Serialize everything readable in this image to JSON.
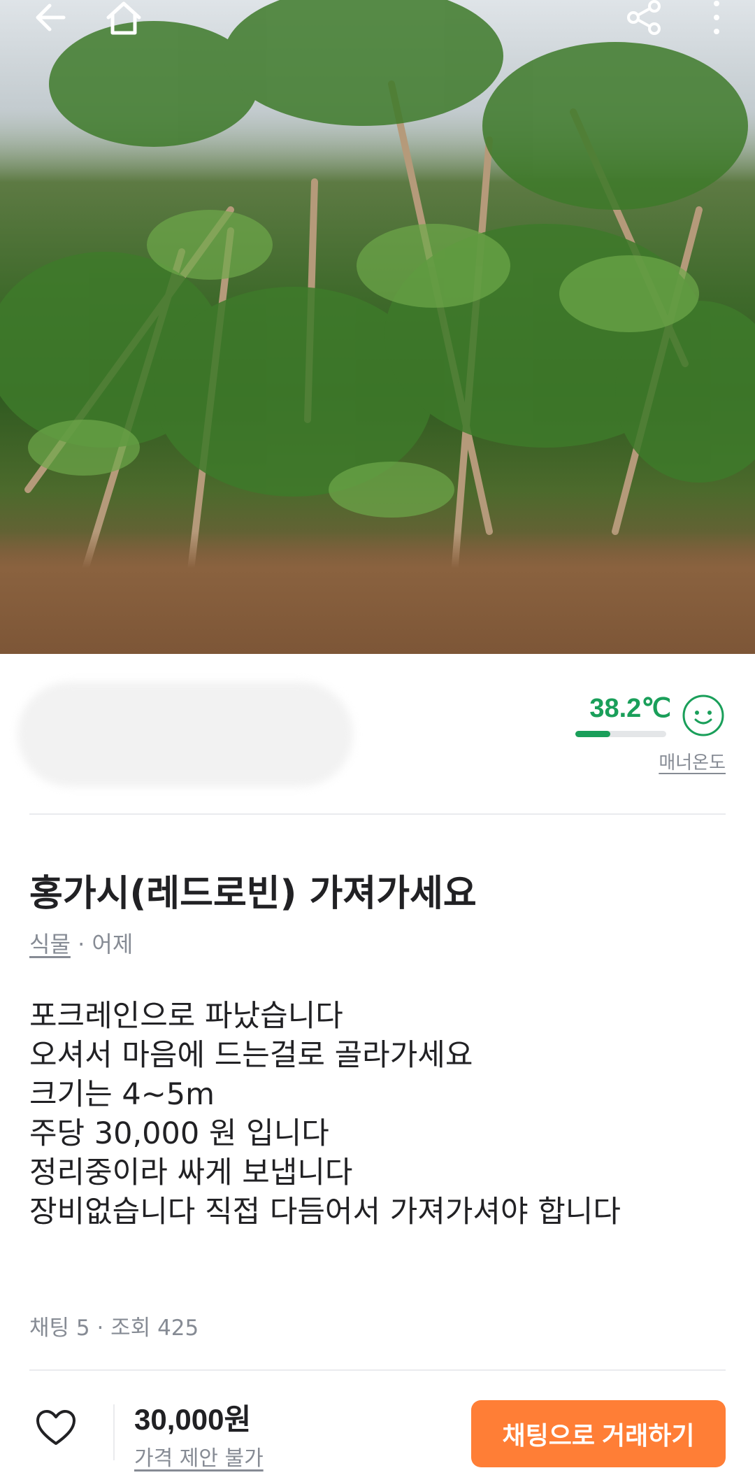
{
  "product_image": {
    "alt": "photo"
  },
  "seller": {
    "manner_temp": "38.2℃",
    "manner_label": "매너온도",
    "temp_level_percent": 38.2,
    "temp_color": "#1a9f5a"
  },
  "post": {
    "title": "홍가시(레드로빈) 가져가세요",
    "category": "식물",
    "separator": " · ",
    "time": "어제",
    "description": [
      "포크레인으로 파났습니다",
      "오셔서 마음에 드는걸로 골라가세요",
      "크기는 4~5m",
      "주당 30,000 원 입니다",
      "정리중이라 싸게 보냅니다",
      "장비없습니다 직접 다듬어서 가져가셔야 합니다"
    ],
    "stats": "채팅 5 · 조회 425"
  },
  "bottom_bar": {
    "price": "30,000원",
    "negotiation": "가격 제안 불가",
    "chat_button": "채팅으로 거래하기",
    "accent": "#ff7e36"
  }
}
